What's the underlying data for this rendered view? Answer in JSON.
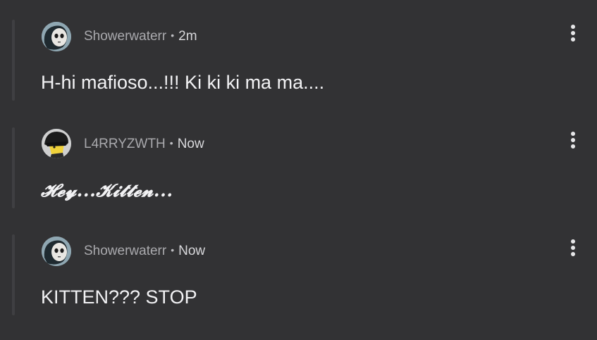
{
  "comments": [
    {
      "username": "Showerwaterr",
      "separator": "•",
      "time": "2m",
      "text": "H-hi mafioso...!!! Ki ki ki ma ma....",
      "avatar_icon": "skull-mask-avatar-icon",
      "menu_icon": "more-vertical-icon"
    },
    {
      "username": "L4RRYZWTH",
      "separator": "•",
      "time": "Now",
      "text": "𝓗𝓮𝔂...𝓚𝓲𝓽𝓽𝓮𝓷...",
      "avatar_icon": "hooded-character-avatar-icon",
      "menu_icon": "more-vertical-icon"
    },
    {
      "username": "Showerwaterr",
      "separator": "•",
      "time": "Now",
      "text": "KITTEN??? STOP",
      "avatar_icon": "skull-mask-avatar-icon",
      "menu_icon": "more-vertical-icon"
    }
  ],
  "colors": {
    "background": "#323234",
    "thread_line": "#3f3f42",
    "username": "#a9a9ad",
    "time": "#d8d8db",
    "text": "#f2f2f4"
  }
}
